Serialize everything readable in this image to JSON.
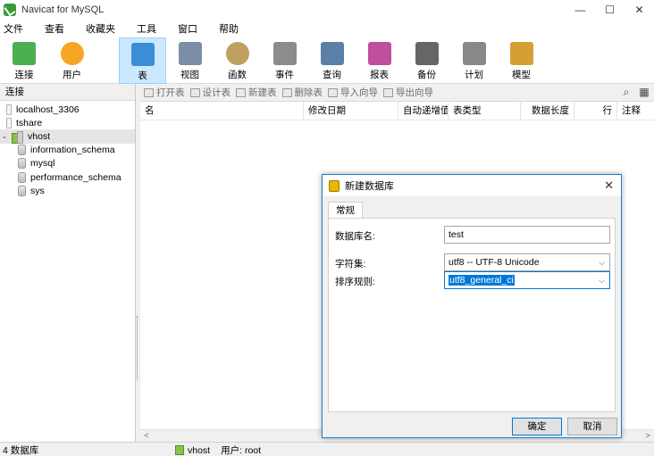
{
  "window": {
    "title": "Navicat for MySQL",
    "minimize_glyph": "—",
    "maximize_glyph": "☐",
    "close_glyph": "✕"
  },
  "menu": [
    "文件",
    "查看",
    "收藏夹",
    "工具",
    "窗口",
    "帮助"
  ],
  "toolbar": [
    {
      "label": "连接",
      "icon": "connection-icon",
      "color": "#4caf50"
    },
    {
      "label": "用户",
      "icon": "user-icon",
      "color": "#f5a623"
    },
    {
      "label": "表",
      "icon": "table-icon",
      "color": "#3c8dd8",
      "active": true
    },
    {
      "label": "视图",
      "icon": "view-icon",
      "color": "#7a8fa6"
    },
    {
      "label": "函数",
      "icon": "function-icon",
      "color": "#c0a060"
    },
    {
      "label": "事件",
      "icon": "event-icon",
      "color": "#8c8c8c"
    },
    {
      "label": "查询",
      "icon": "query-icon",
      "color": "#5c7fa6"
    },
    {
      "label": "报表",
      "icon": "report-icon",
      "color": "#c04fa0"
    },
    {
      "label": "备份",
      "icon": "backup-icon",
      "color": "#666666"
    },
    {
      "label": "计划",
      "icon": "schedule-icon",
      "color": "#888888"
    },
    {
      "label": "模型",
      "icon": "model-icon",
      "color": "#d4a033"
    }
  ],
  "left_panel": {
    "header": "连接",
    "tree": [
      {
        "label": "localhost_3306",
        "type": "connection"
      },
      {
        "label": "tshare",
        "type": "connection"
      },
      {
        "label": "vhost",
        "type": "connection-open",
        "expander": "⌄",
        "selected": true
      },
      {
        "label": "information_schema",
        "type": "database"
      },
      {
        "label": "mysql",
        "type": "database"
      },
      {
        "label": "performance_schema",
        "type": "database"
      },
      {
        "label": "sys",
        "type": "database"
      }
    ]
  },
  "object_toolbar": {
    "buttons": [
      "打开表",
      "设计表",
      "新建表",
      "删除表",
      "导入向导",
      "导出向导"
    ],
    "search_glyph": "⌕",
    "view_glyph": "▦"
  },
  "columns": [
    {
      "label": "名"
    },
    {
      "label": "修改日期"
    },
    {
      "label": "自动递增值"
    },
    {
      "label": "表类型"
    },
    {
      "label": "数据长度",
      "align": "right"
    },
    {
      "label": "行",
      "align": "right"
    },
    {
      "label": "注释"
    }
  ],
  "scroll": {
    "left_glyph": "<",
    "right_glyph": ">"
  },
  "status": {
    "left": "4 数据库",
    "connection": "vhost",
    "user": "用户: root"
  },
  "dialog": {
    "title": "新建数据库",
    "close_glyph": "✕",
    "tab": "常规",
    "name_label": "数据库名:",
    "name_value": "test",
    "charset_label": "字符集:",
    "charset_value": "utf8 -- UTF-8 Unicode",
    "collation_label": "排序规则:",
    "collation_value": "utf8_general_ci",
    "chevron": "⌵",
    "ok": "确定",
    "cancel": "取消"
  }
}
